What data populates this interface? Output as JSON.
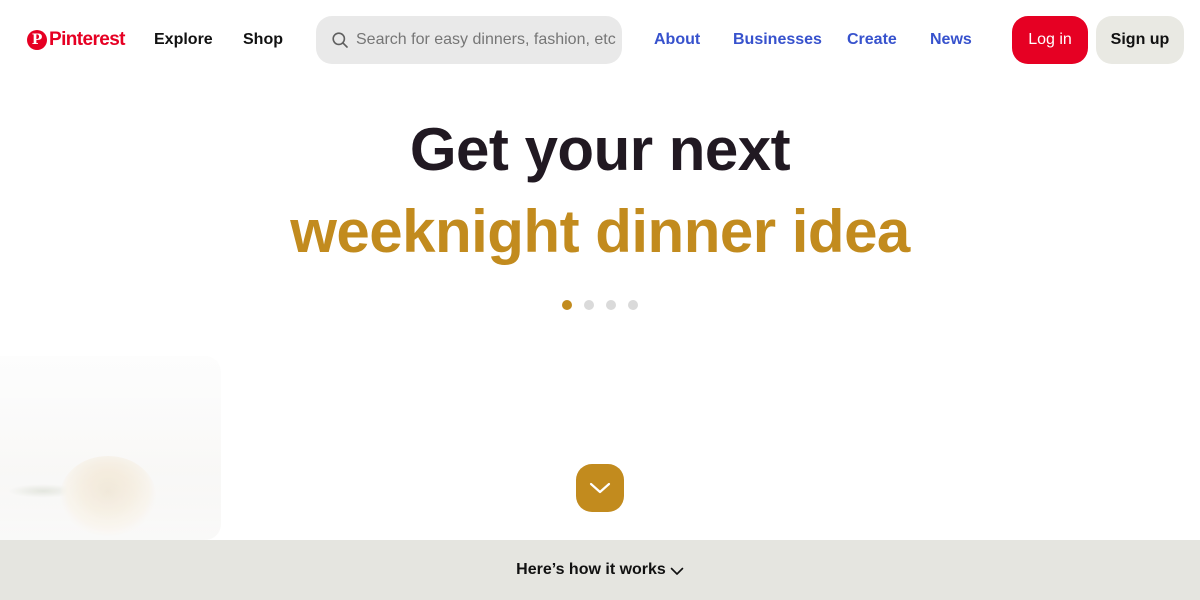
{
  "brand": {
    "name": "Pinterest",
    "color": "#e60023",
    "icon": "pinterest-logo-icon"
  },
  "nav": {
    "explore": "Explore",
    "shop": "Shop"
  },
  "search": {
    "placeholder": "Search for easy dinners, fashion, etc.",
    "icon": "search-icon"
  },
  "links": {
    "about": "About",
    "businesses": "Businesses",
    "create": "Create",
    "news": "News"
  },
  "auth": {
    "login": "Log in",
    "signup": "Sign up"
  },
  "hero": {
    "line1": "Get your next",
    "line2": "weeknight dinner idea",
    "accent_color": "#c28b1e",
    "carousel_slides": 4,
    "active_slide": 1
  },
  "scroll_button": {
    "icon": "chevron-down-icon"
  },
  "footer": {
    "how_it_works": "Here’s how it works",
    "icon": "chevron-down-icon"
  }
}
